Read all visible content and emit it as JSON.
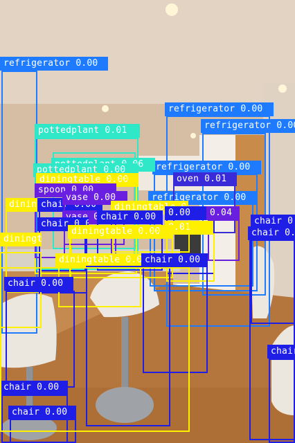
{
  "palette": {
    "wall": "#d8c3ad",
    "ceiling": "#e2d3c3",
    "floor": "#b7783d",
    "cabinet": "#f4f1ec",
    "wood": "#c98b4a",
    "counter": "#d9d3c8",
    "stool_seat": "#ece9e2",
    "chrome": "#8c8f94"
  },
  "detections": [
    {
      "text": "refrigerator 0.00",
      "color": "#1e7bff",
      "text_color": "#ffffff"
    },
    {
      "text": "refrigerator 0.00",
      "color": "#1e7bff",
      "text_color": "#ffffff"
    },
    {
      "text": "refrigerator 0.00",
      "color": "#1e7bff",
      "text_color": "#ffffff"
    },
    {
      "text": "refrigerator 0.00",
      "color": "#1e7bff",
      "text_color": "#ffffff"
    },
    {
      "text": "refrigerator 0.00",
      "color": "#1e7bff",
      "text_color": "#ffffff"
    },
    {
      "text": "pottedplant 0.01",
      "color": "#2ee8c8",
      "text_color": "#ffffff"
    },
    {
      "text": "pottedplant 0.06",
      "color": "#2ee8c8",
      "text_color": "#ffffff"
    },
    {
      "text": "pottedplant 0.00",
      "color": "#2ee8c8",
      "text_color": "#ffffff"
    },
    {
      "text": "diningtable 0.00",
      "color": "#fff000",
      "text_color": "#ffffff"
    },
    {
      "text": "spoon 0.00",
      "color": "#6a1ee0",
      "text_color": "#ffffff"
    },
    {
      "text": "oven 0.01",
      "color": "#3a2bd8",
      "text_color": "#ffffff"
    },
    {
      "text": "diningtable 0.00",
      "color": "#fff000",
      "text_color": "#ffffff"
    },
    {
      "text": "chair 0.00",
      "color": "#1e1ee6",
      "text_color": "#ffffff"
    },
    {
      "text": "vase 0.00",
      "color": "#6a1ee0",
      "text_color": "#ffffff"
    },
    {
      "text": "diningtable 0.00",
      "color": "#fff000",
      "text_color": "#ffffff"
    },
    {
      "text": "vase 0.00",
      "color": "#6a1ee0",
      "text_color": "#ffffff"
    },
    {
      "text": "chair 0.00",
      "color": "#1e1ee6",
      "text_color": "#ffffff"
    },
    {
      "text": "chair 0.00",
      "color": "#1e1ee6",
      "text_color": "#ffffff"
    },
    {
      "text": "0.00",
      "color": "#1e1ee6",
      "text_color": "#ffffff"
    },
    {
      "text": "0.04",
      "color": "#6a1ee0",
      "text_color": "#ffffff"
    },
    {
      "text": "0.01",
      "color": "#fff000",
      "text_color": "#ffffff"
    },
    {
      "text": "diningtable 0.00",
      "color": "#fff000",
      "text_color": "#ffffff"
    },
    {
      "text": "diningtable 0.00",
      "color": "#fff000",
      "text_color": "#ffffff"
    },
    {
      "text": "diningtable 0.00",
      "color": "#fff000",
      "text_color": "#ffffff"
    },
    {
      "text": "chair 0.00",
      "color": "#1e1ee6",
      "text_color": "#ffffff"
    },
    {
      "text": "chair 0.00",
      "color": "#1e1ee6",
      "text_color": "#ffffff"
    },
    {
      "text": "chair 0.00",
      "color": "#1e1ee6",
      "text_color": "#ffffff"
    },
    {
      "text": "chair 0.00",
      "color": "#1e1ee6",
      "text_color": "#ffffff"
    },
    {
      "text": "chair 0.00",
      "color": "#1e1ee6",
      "text_color": "#ffffff"
    },
    {
      "text": "chair 0.00",
      "color": "#1e1ee6",
      "text_color": "#ffffff"
    },
    {
      "text": "chair 0.00",
      "color": "#1e1ee6",
      "text_color": "#ffffff"
    },
    {
      "text": "chair 0.00",
      "color": "#1e1ee6",
      "text_color": "#ffffff"
    }
  ]
}
